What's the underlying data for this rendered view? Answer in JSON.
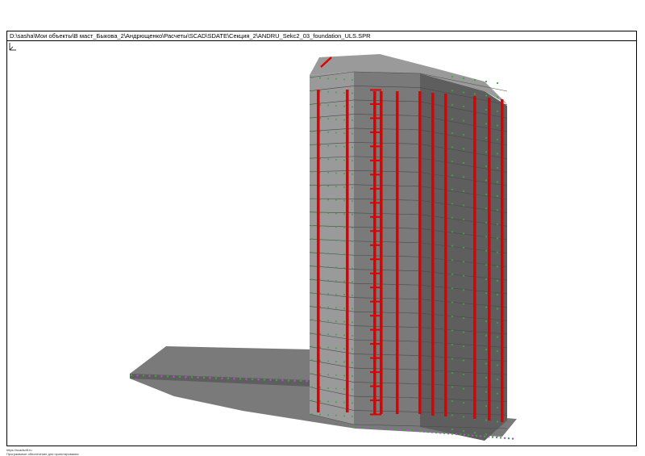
{
  "window": {
    "file_path": "D:\\sasha\\Мои объекты\\В маст_Быкова_2\\Андрющенко\\Расчеты\\SCAD\\SDATE\\Секция_2\\ANDRU_Sekc2_03_foundation_ULS.SPR"
  },
  "viewport": {
    "model_gray": "#7a7a7a",
    "model_gray_light": "#9a9a9a",
    "model_gray_dark": "#5e5e5e",
    "column_red": "#e00000",
    "node_green": "#3aa83a",
    "node_purple": "#b24ed6",
    "floor_count": 25
  },
  "footer": {
    "line1": "https://scadsoft.ru",
    "line2": "Программное обеспечение для проектирования"
  },
  "icons": {
    "axis": "axis-triad-icon"
  }
}
